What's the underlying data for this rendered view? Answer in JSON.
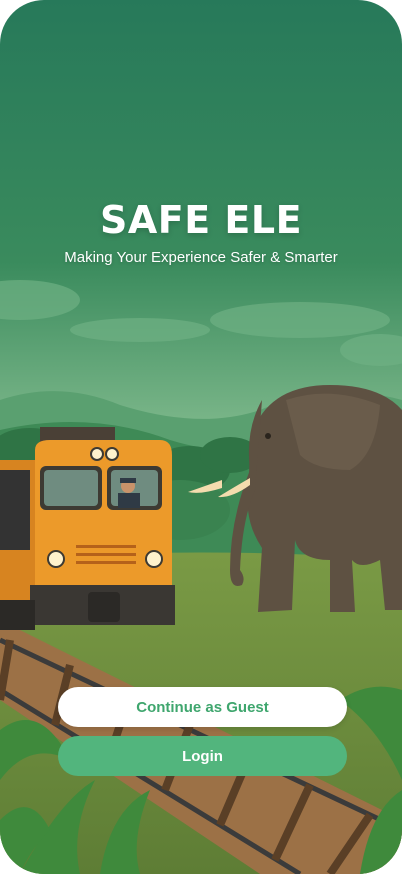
{
  "app": {
    "title": "SAFE ELE",
    "subtitle": "Making Your Experience Safer & Smarter"
  },
  "actions": {
    "guest_label": "Continue as Guest",
    "login_label": "Login"
  },
  "colors": {
    "sky_top": "#2a7b55",
    "sky_bottom": "#8fc39a",
    "guest_text": "#3fa66e",
    "login_button": "#52b57d",
    "train_body": "#ec9a2a",
    "elephant": "#5e5142"
  }
}
